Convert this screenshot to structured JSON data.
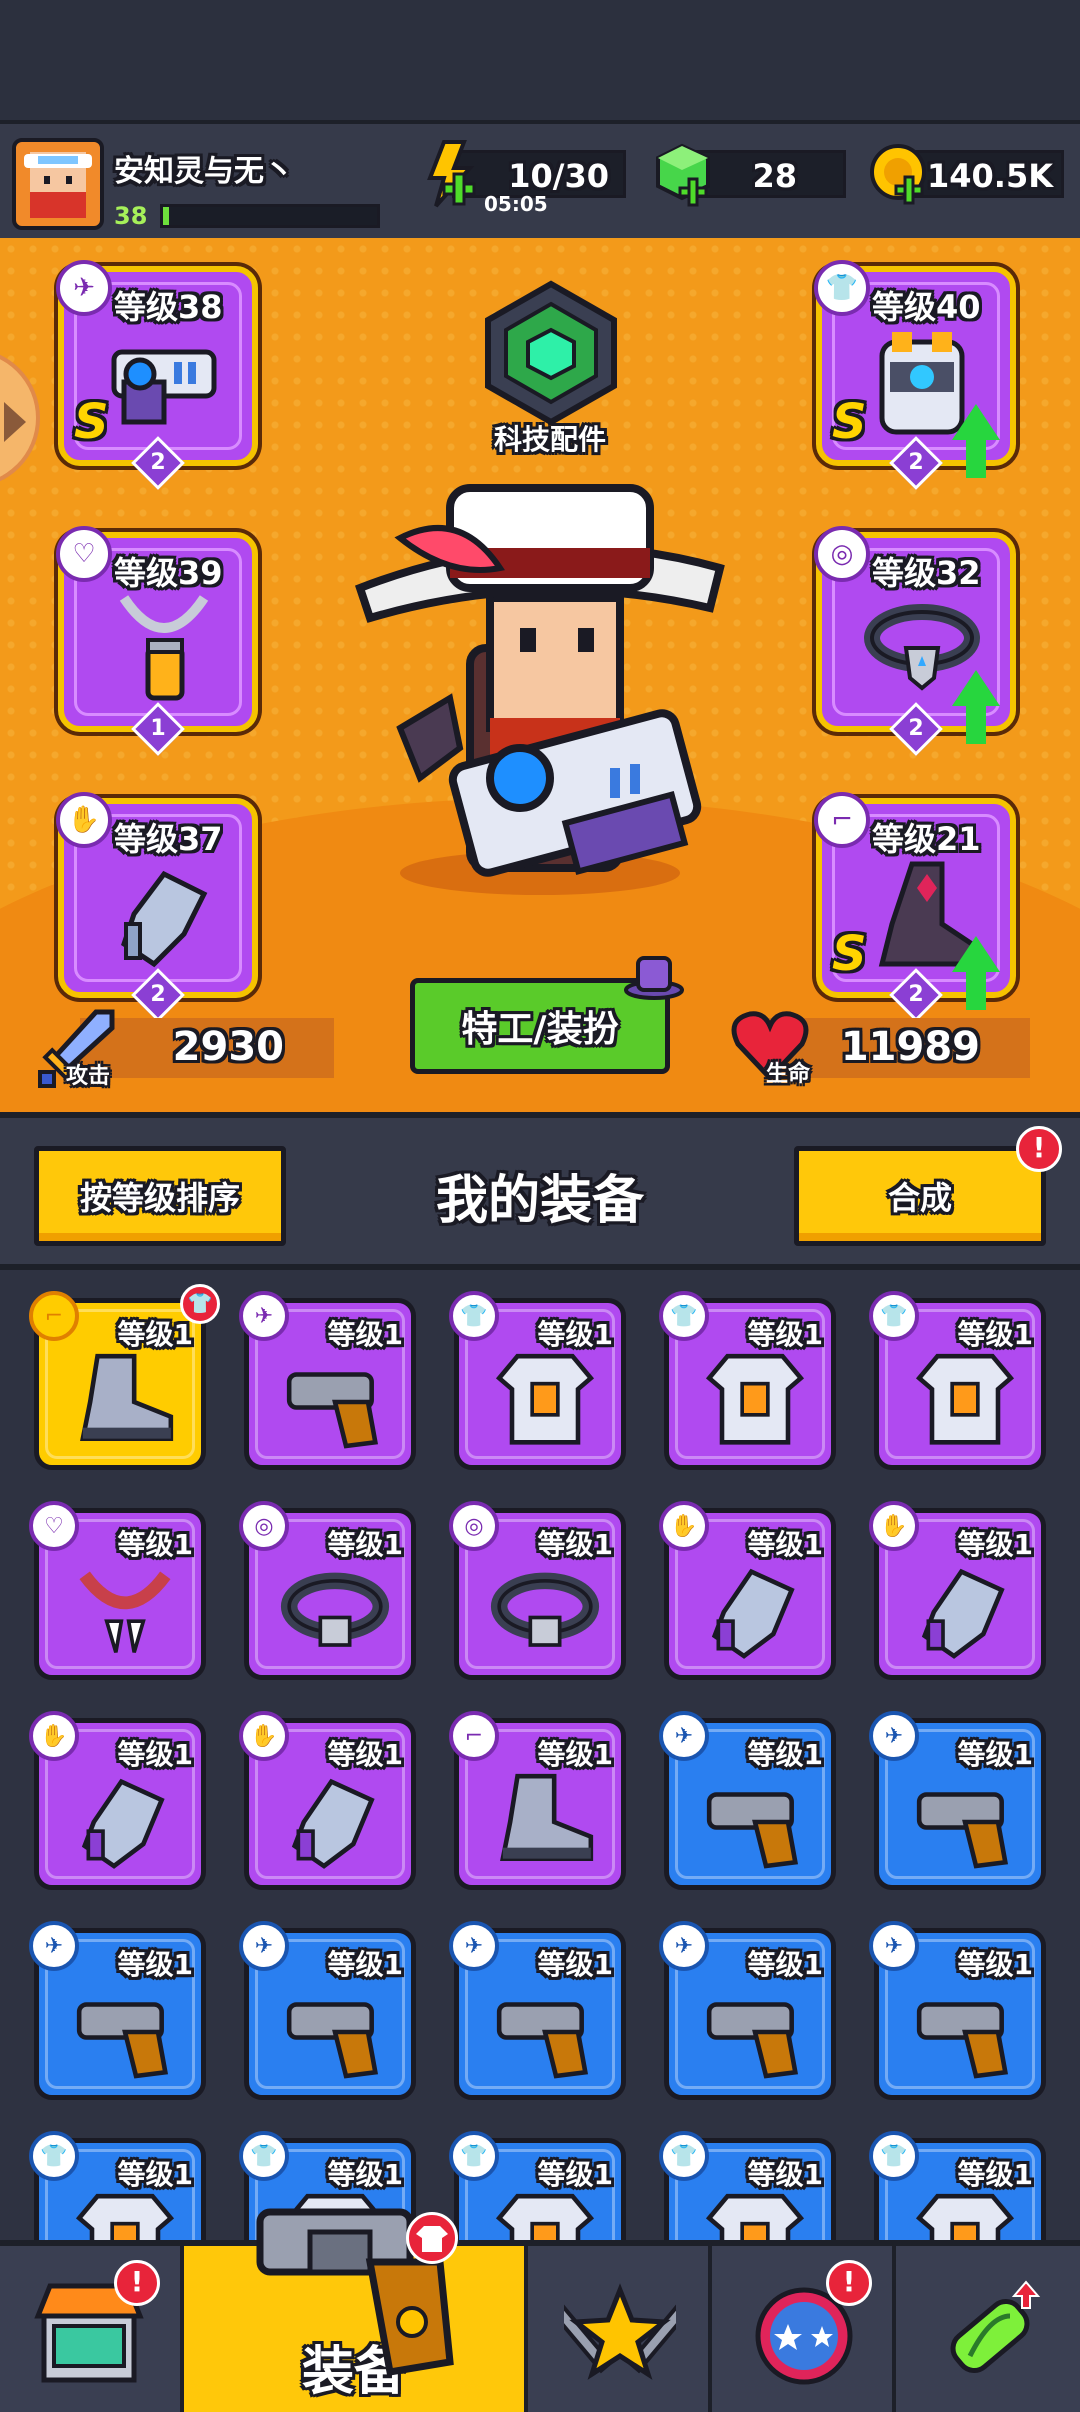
{
  "player": {
    "name": "安知灵与无丶",
    "level": "38",
    "xp_fraction": 0.03
  },
  "resources": {
    "energy": {
      "value": "10/30",
      "timer": "05:05",
      "icon": "energy-bolt-icon"
    },
    "gems": {
      "value": "28",
      "icon": "green-gem-icon"
    },
    "coins": {
      "value": "140.5K",
      "icon": "gold-coin-icon"
    }
  },
  "equipped": {
    "weapon": {
      "level_label": "等级38",
      "count": "2",
      "rarity": "S",
      "icon": "gun-icon"
    },
    "armor": {
      "level_label": "等级40",
      "count": "2",
      "rarity": "S",
      "icon": "shirt-icon",
      "upgrade": true
    },
    "necklace": {
      "level_label": "等级39",
      "count": "1",
      "icon": "necklace-icon"
    },
    "belt": {
      "level_label": "等级32",
      "count": "2",
      "icon": "belt-icon",
      "upgrade": true
    },
    "glove": {
      "level_label": "等级37",
      "count": "2",
      "icon": "glove-icon"
    },
    "boots": {
      "level_label": "等级21",
      "count": "2",
      "rarity": "S",
      "icon": "boot-icon",
      "upgrade": true
    }
  },
  "tech": {
    "label": "科技配件"
  },
  "agent_button": {
    "label": "特工/装扮"
  },
  "stats": {
    "attack": {
      "label": "攻击",
      "value": "2930"
    },
    "hp": {
      "label": "生命",
      "value": "11989"
    }
  },
  "inventory": {
    "title": "我的装备",
    "sort_button": "按等级排序",
    "merge_button": "合成",
    "alert_mark": "!",
    "items": [
      {
        "level": "等级1",
        "rarity": "gold",
        "type": "boot"
      },
      {
        "level": "等级1",
        "rarity": "purple",
        "type": "gun"
      },
      {
        "level": "等级1",
        "rarity": "purple",
        "type": "shirt"
      },
      {
        "level": "等级1",
        "rarity": "purple",
        "type": "shirt"
      },
      {
        "level": "等级1",
        "rarity": "purple",
        "type": "shirt"
      },
      {
        "level": "等级1",
        "rarity": "purple",
        "type": "necklace"
      },
      {
        "level": "等级1",
        "rarity": "purple",
        "type": "belt"
      },
      {
        "level": "等级1",
        "rarity": "purple",
        "type": "belt"
      },
      {
        "level": "等级1",
        "rarity": "purple",
        "type": "glove"
      },
      {
        "level": "等级1",
        "rarity": "purple",
        "type": "glove"
      },
      {
        "level": "等级1",
        "rarity": "purple",
        "type": "glove"
      },
      {
        "level": "等级1",
        "rarity": "purple",
        "type": "glove"
      },
      {
        "level": "等级1",
        "rarity": "purple",
        "type": "boot"
      },
      {
        "level": "等级1",
        "rarity": "blue",
        "type": "gun"
      },
      {
        "level": "等级1",
        "rarity": "blue",
        "type": "gun"
      },
      {
        "level": "等级1",
        "rarity": "blue",
        "type": "gun"
      },
      {
        "level": "等级1",
        "rarity": "blue",
        "type": "gun"
      },
      {
        "level": "等级1",
        "rarity": "blue",
        "type": "gun"
      },
      {
        "level": "等级1",
        "rarity": "blue",
        "type": "gun"
      },
      {
        "level": "等级1",
        "rarity": "blue",
        "type": "gun"
      },
      {
        "level": "等级1",
        "rarity": "blue",
        "type": "shirt"
      },
      {
        "level": "等级1",
        "rarity": "blue",
        "type": "shirt"
      },
      {
        "level": "等级1",
        "rarity": "blue",
        "type": "shirt"
      },
      {
        "level": "等级1",
        "rarity": "blue",
        "type": "shirt"
      },
      {
        "level": "等级1",
        "rarity": "blue",
        "type": "shirt"
      }
    ]
  },
  "nav": {
    "shop": {
      "icon": "shop-icon",
      "alert": "!"
    },
    "equipment": {
      "label": "装备",
      "icon": "revolver-icon"
    },
    "battle": {
      "icon": "crossed-swords-star-icon"
    },
    "events": {
      "icon": "star-ball-icon",
      "alert": "!"
    },
    "dna": {
      "icon": "dna-capsule-icon"
    }
  },
  "colors": {
    "orange_bg": "#f39a1a",
    "purple_rarity": "#b04af0",
    "blue_rarity": "#2a7ff0",
    "gold_rarity": "#ffcc00",
    "button_yellow": "#ffc80a",
    "button_green": "#5acb2a"
  }
}
